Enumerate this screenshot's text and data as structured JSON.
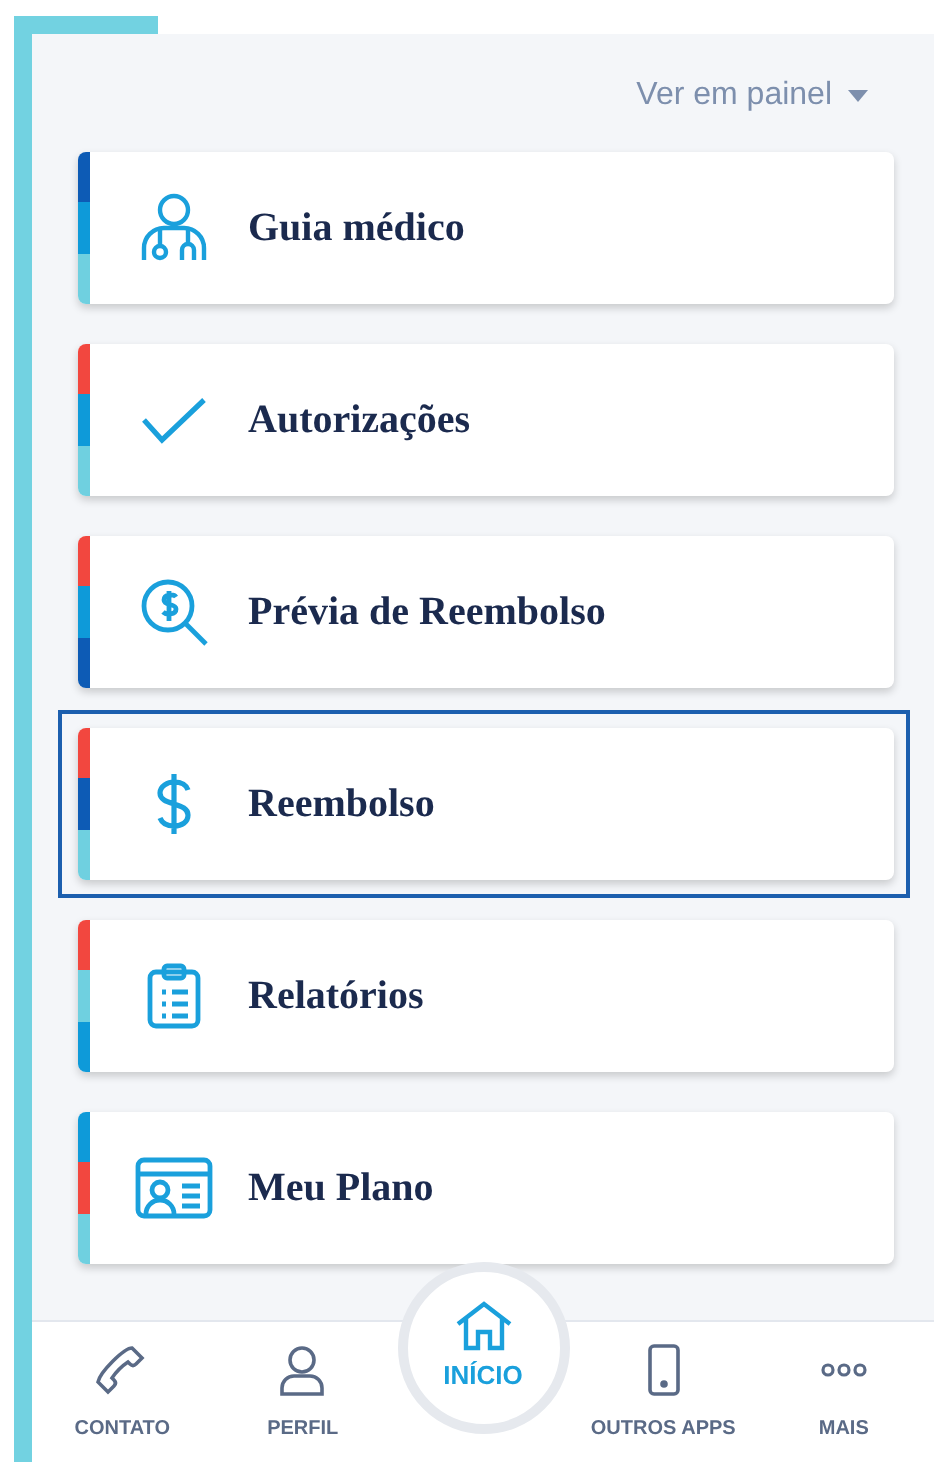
{
  "view_selector": {
    "label": "Ver em painel"
  },
  "cards": [
    {
      "title": "Guia médico",
      "selected": false,
      "stripe": [
        {
          "color": "#0d5bb5"
        },
        {
          "color": "#0e9ad9"
        },
        {
          "color": "#6fd0e0"
        }
      ]
    },
    {
      "title": "Autorizações",
      "selected": false,
      "stripe": [
        {
          "color": "#f2473f"
        },
        {
          "color": "#0e9ad9"
        },
        {
          "color": "#6fd0e0"
        }
      ]
    },
    {
      "title": "Prévia de Reembolso",
      "selected": false,
      "stripe": [
        {
          "color": "#f2473f"
        },
        {
          "color": "#0e9ad9"
        },
        {
          "color": "#0d5bb5"
        }
      ]
    },
    {
      "title": "Reembolso",
      "selected": true,
      "stripe": [
        {
          "color": "#f2473f"
        },
        {
          "color": "#0d5bb5"
        },
        {
          "color": "#6fd0e0"
        }
      ]
    },
    {
      "title": "Relatórios",
      "selected": false,
      "stripe": [
        {
          "color": "#f2473f"
        },
        {
          "color": "#6fd0e0"
        },
        {
          "color": "#0e9ad9"
        }
      ]
    },
    {
      "title": "Meu Plano",
      "selected": false,
      "stripe": [
        {
          "color": "#0e9ad9"
        },
        {
          "color": "#f2473f"
        },
        {
          "color": "#6fd0e0"
        }
      ]
    }
  ],
  "bottom_nav": [
    {
      "label": "CONTATO",
      "selected": false
    },
    {
      "label": "PERFIL",
      "selected": false
    },
    {
      "label": "INÍCIO",
      "selected": true
    },
    {
      "label": "OUTROS APPS",
      "selected": false
    },
    {
      "label": "MAIS",
      "selected": false
    }
  ]
}
